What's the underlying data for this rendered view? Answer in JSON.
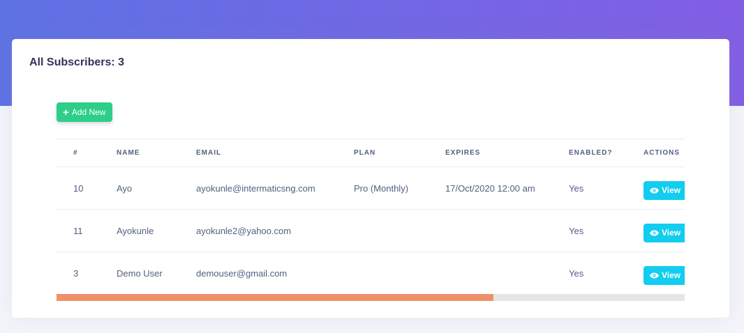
{
  "header": {
    "title_prefix": "All Subscribers:",
    "count": "3"
  },
  "toolbar": {
    "add_label": "Add New"
  },
  "table": {
    "columns": [
      "#",
      "NAME",
      "EMAIL",
      "PLAN",
      "EXPIRES",
      "ENABLED?",
      "ACTIONS"
    ],
    "rows": [
      {
        "id": "10",
        "name": "Ayo",
        "email": "ayokunle@intermaticsng.com",
        "plan": "Pro (Monthly)",
        "expires": "17/Oct/2020 12:00 am",
        "enabled": "Yes",
        "action": "View"
      },
      {
        "id": "11",
        "name": "Ayokunle",
        "email": "ayokunle2@yahoo.com",
        "plan": "",
        "expires": "",
        "enabled": "Yes",
        "action": "View"
      },
      {
        "id": "3",
        "name": "Demo User",
        "email": "demouser@gmail.com",
        "plan": "",
        "expires": "",
        "enabled": "Yes",
        "action": "View"
      }
    ]
  },
  "scroll": {
    "position_fraction": 0.0,
    "visible_fraction": 0.695
  },
  "icons": {
    "add": "plus-icon",
    "view": "eye-icon"
  },
  "colors": {
    "hero_start": "#5e72e4",
    "hero_end": "#825ee4",
    "success": "#2dce89",
    "info": "#11cdef",
    "scroll_thumb": "#f0906a"
  }
}
